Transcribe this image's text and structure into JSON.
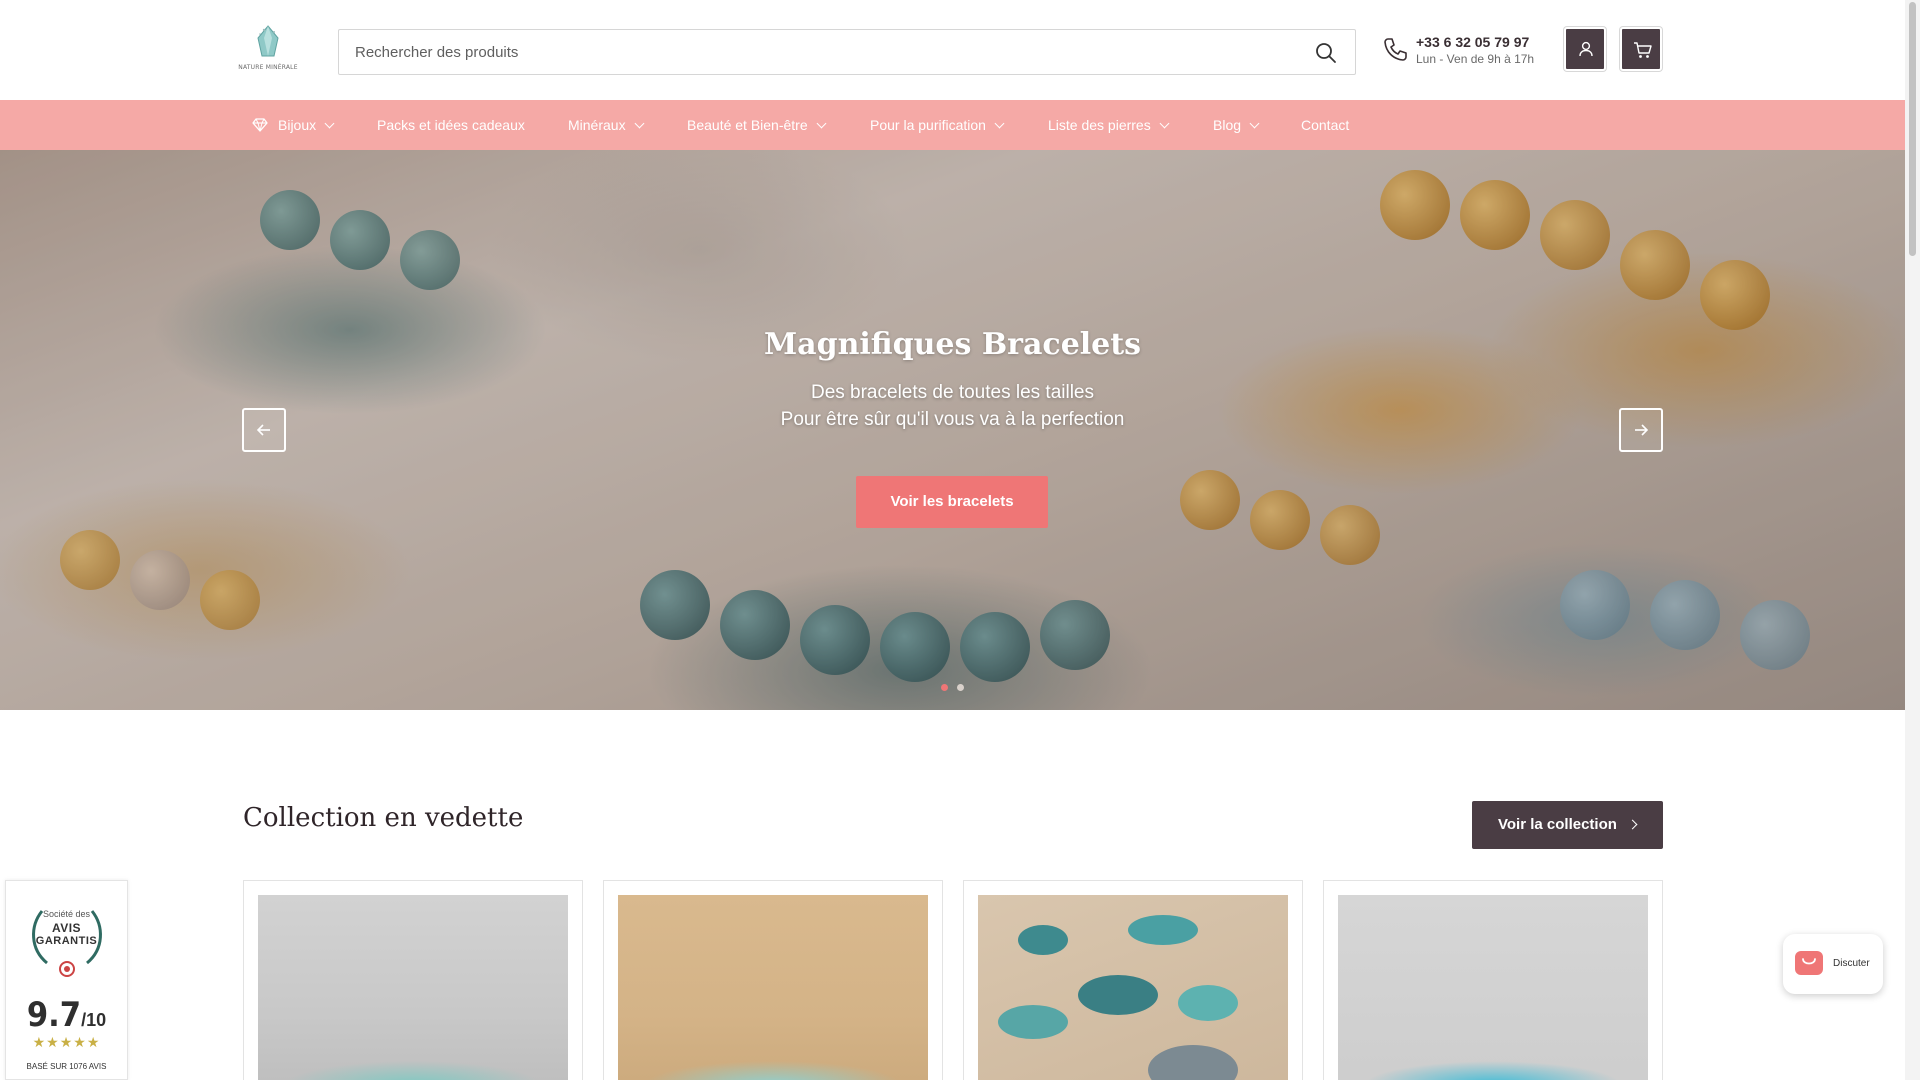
{
  "brand": {
    "logo_text": "NATURE MINÉRALE"
  },
  "header": {
    "search_placeholder": "Rechercher des produits",
    "phone_number": "+33 6 32 05 79 97",
    "phone_hours": "Lun - Ven de 9h à 17h",
    "icons": [
      "search-icon",
      "phone-icon",
      "user-icon",
      "cart-icon"
    ]
  },
  "nav": {
    "items": [
      {
        "label": "Bijoux",
        "dropdown": true,
        "icon": "gem-icon"
      },
      {
        "label": "Packs et idées cadeaux",
        "dropdown": false
      },
      {
        "label": "Minéraux",
        "dropdown": true
      },
      {
        "label": "Beauté et Bien-être",
        "dropdown": true
      },
      {
        "label": "Pour la purification",
        "dropdown": true
      },
      {
        "label": "Liste des pierres",
        "dropdown": true
      },
      {
        "label": "Blog",
        "dropdown": true
      },
      {
        "label": "Contact",
        "dropdown": false
      }
    ]
  },
  "hero": {
    "title": "Magnifiques Bracelets",
    "subtitle_line1": "Des bracelets de toutes les tailles",
    "subtitle_line2": "Pour être sûr qu'il vous va à la perfection",
    "cta_label": "Voir les bracelets",
    "slides_count": 2,
    "active_slide": 1
  },
  "featured": {
    "title": "Collection en vedette",
    "button_label": "Voir la collection"
  },
  "reviews_badge": {
    "line1": "Société des",
    "line2": "AVIS",
    "line3": "GARANTIS",
    "score": "9.7",
    "score_max": "/10",
    "stars": "★★★★★",
    "count_text": "BASÉ SUR 1076 AVIS"
  },
  "chat": {
    "label": "Discuter"
  },
  "colors": {
    "nav_bg": "#f5a9a6",
    "accent": "#ef7676",
    "dark": "#4a3d44"
  }
}
